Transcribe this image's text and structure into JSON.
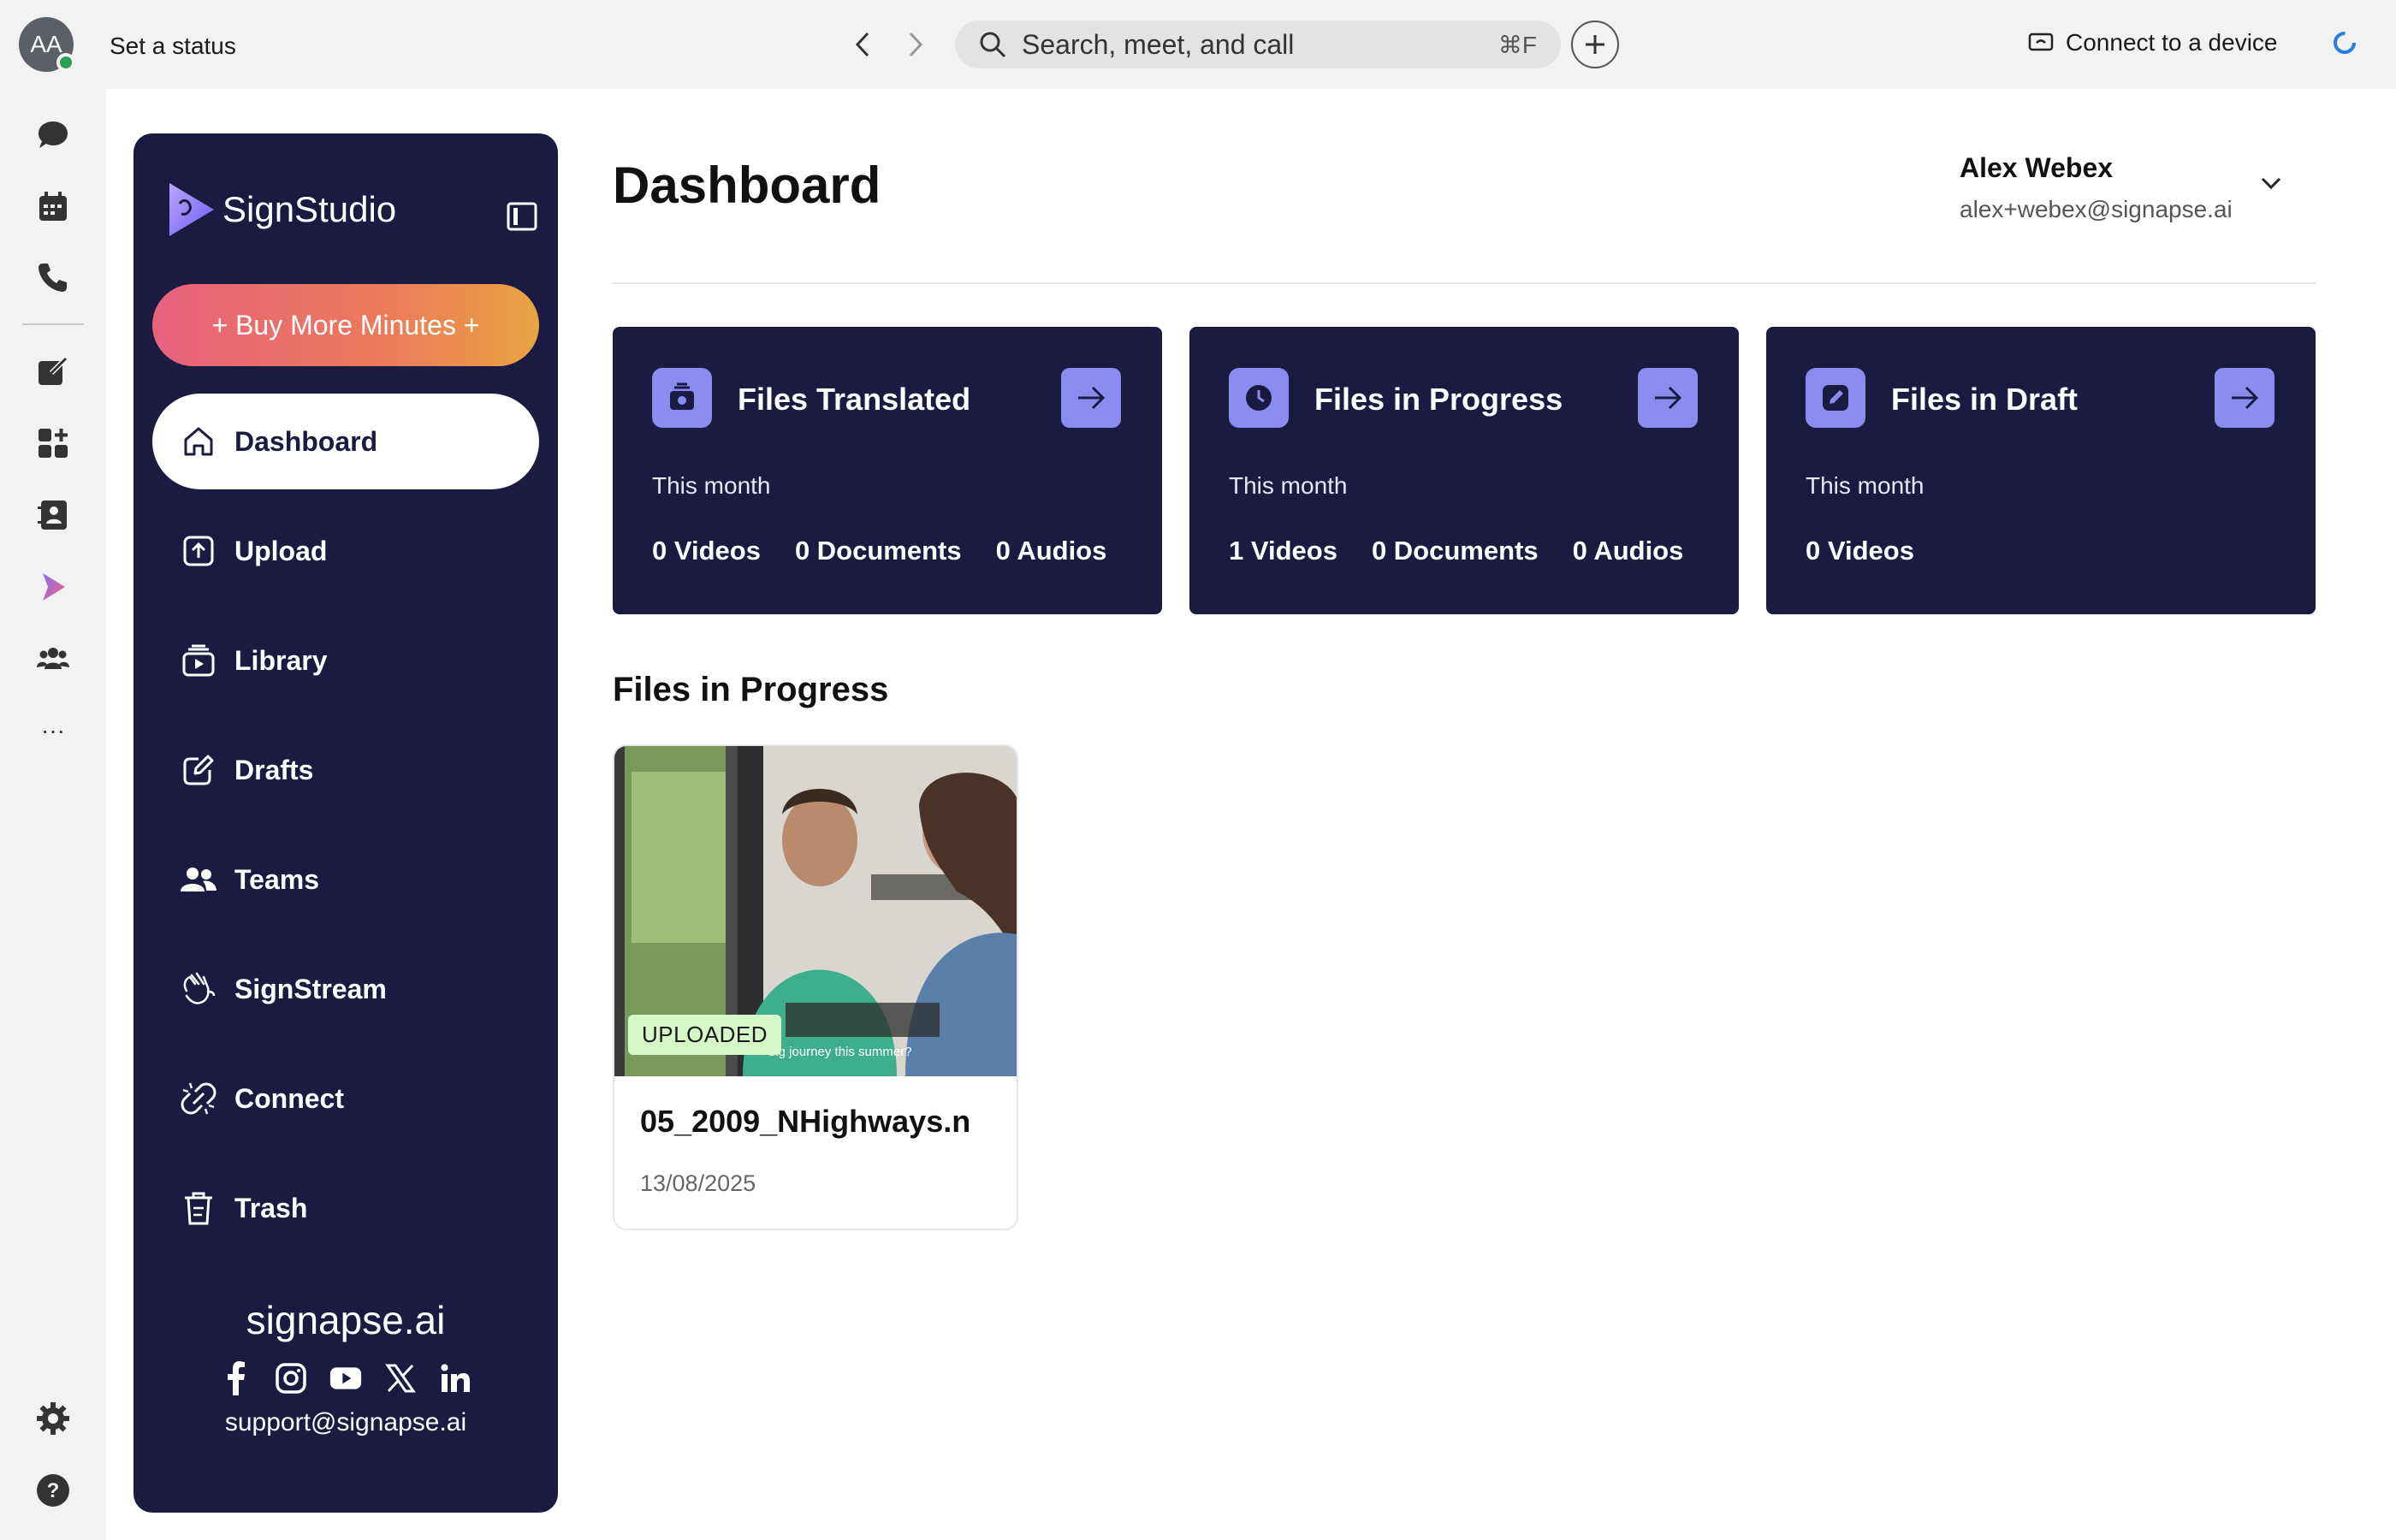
{
  "topbar": {
    "avatar_initials": "AA",
    "set_status": "Set a status",
    "search_placeholder": "Search, meet, and call",
    "search_shortcut": "⌘F",
    "connect_device": "Connect to a device"
  },
  "rail": {
    "items": [
      "chat-icon",
      "calendar-icon",
      "phone-icon",
      "compose-icon",
      "apps-icon",
      "contacts-icon",
      "signstudio-icon",
      "people-icon",
      "more-icon"
    ],
    "more_label": "···"
  },
  "sidebar": {
    "brand": "SignStudio",
    "buy_button": "+ Buy More Minutes +",
    "items": [
      {
        "label": "Dashboard",
        "icon": "home-icon",
        "active": true
      },
      {
        "label": "Upload",
        "icon": "upload-icon"
      },
      {
        "label": "Library",
        "icon": "library-icon"
      },
      {
        "label": "Drafts",
        "icon": "drafts-icon"
      },
      {
        "label": "Teams",
        "icon": "teams-icon"
      },
      {
        "label": "SignStream",
        "icon": "signstream-icon"
      },
      {
        "label": "Connect",
        "icon": "connect-icon"
      },
      {
        "label": "Trash",
        "icon": "trash-icon"
      }
    ],
    "footer": {
      "site": "signapse.ai",
      "socials": [
        "facebook-icon",
        "instagram-icon",
        "youtube-icon",
        "x-icon",
        "linkedin-icon"
      ],
      "support_email": "support@signapse.ai"
    }
  },
  "main": {
    "title": "Dashboard",
    "user": {
      "name": "Alex Webex",
      "email": "alex+webex@signapse.ai"
    },
    "cards": [
      {
        "title": "Files Translated",
        "period": "This month",
        "counts": [
          "0 Videos",
          "0 Documents",
          "0 Audios"
        ]
      },
      {
        "title": "Files in Progress",
        "period": "This month",
        "counts": [
          "1 Videos",
          "0 Documents",
          "0 Audios"
        ]
      },
      {
        "title": "Files in Draft",
        "period": "This month",
        "counts": [
          "0 Videos"
        ]
      }
    ],
    "section_title": "Files in Progress",
    "files": [
      {
        "status": "UPLOADED",
        "name": "05_2009_NHighways.n",
        "date": "13/08/2025",
        "caption": "big journey this summer?"
      }
    ]
  },
  "colors": {
    "sidebar_bg": "#1b1b42",
    "accent": "#8b8cf0",
    "badge_bg": "#d4f8c8"
  }
}
